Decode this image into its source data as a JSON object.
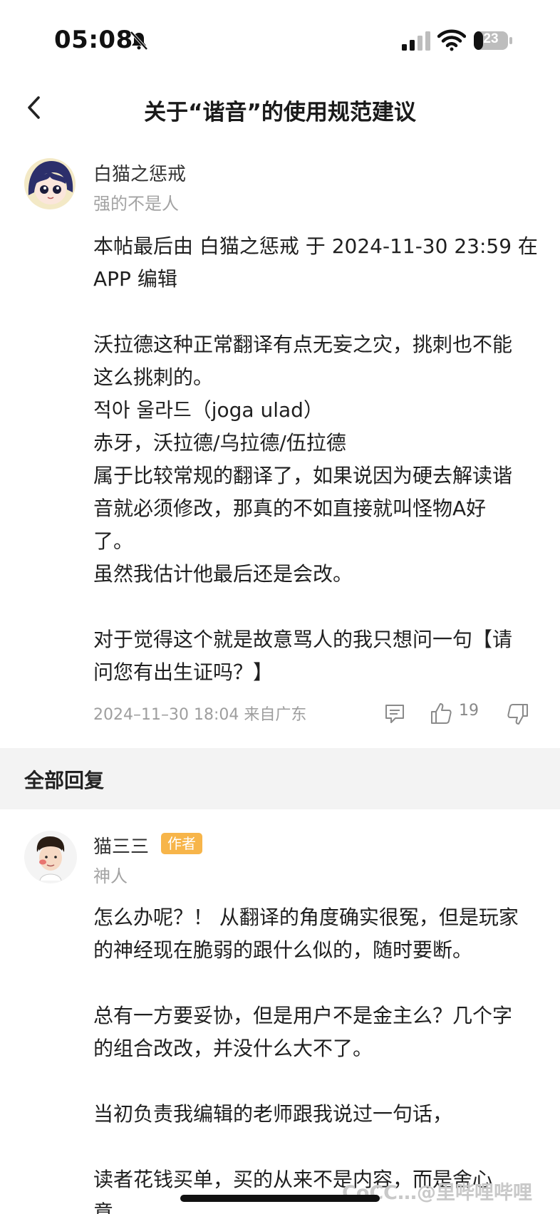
{
  "status_bar": {
    "time": "05:08",
    "battery": "23",
    "icons": [
      "bell-muted-icon",
      "signal-icon",
      "wifi-icon",
      "battery-icon"
    ]
  },
  "nav": {
    "back_icon": "chevron-left-icon",
    "title": "关于“谐音”的使用规范建议"
  },
  "post": {
    "author": "白猫之惩戒",
    "subtitle": "强的不是人",
    "paragraphs": [
      "本帖最后由 白猫之惩戒 于 2024-11-30 23:59 在",
      "APP 编辑",
      "",
      "沃拉德这种正常翻译有点无妄之灾，挑刺也不能",
      "这么挑刺的。",
      "적아 울라드（joga ulad）",
      "赤牙，沃拉德/乌拉德/伍拉德",
      "属于比较常规的翻译了，如果说因为硬去解读谐",
      "音就必须修改，那真的不如直接就叫怪物A好",
      "了。",
      "虽然我估计他最后还是会改。",
      "",
      "对于觉得这个就是故意骂人的我只想问一句【请",
      "问您有出生证吗？】"
    ],
    "meta": "2024–11–30 18:04  来自广东",
    "like_count": "19"
  },
  "section": {
    "title": "全部回复"
  },
  "reply": {
    "author": "猫三三",
    "badge": "作者",
    "subtitle": "神人",
    "paragraphs": [
      "怎么办呢？！ 从翻译的角度确实很冤，但是玩家",
      "的神经现在脆弱的跟什么似的，随时要断。",
      "",
      "总有一方要妥协，但是用户不是金主么？几个字",
      "的组合改改，并没什么大不了。",
      "",
      "当初负责我编辑的老师跟我说过一句话，",
      "",
      "读者花钱买单，买的从来不是内容，而是舍心",
      "意"
    ]
  },
  "watermark": "CoCC…@里哔哩哔哩"
}
